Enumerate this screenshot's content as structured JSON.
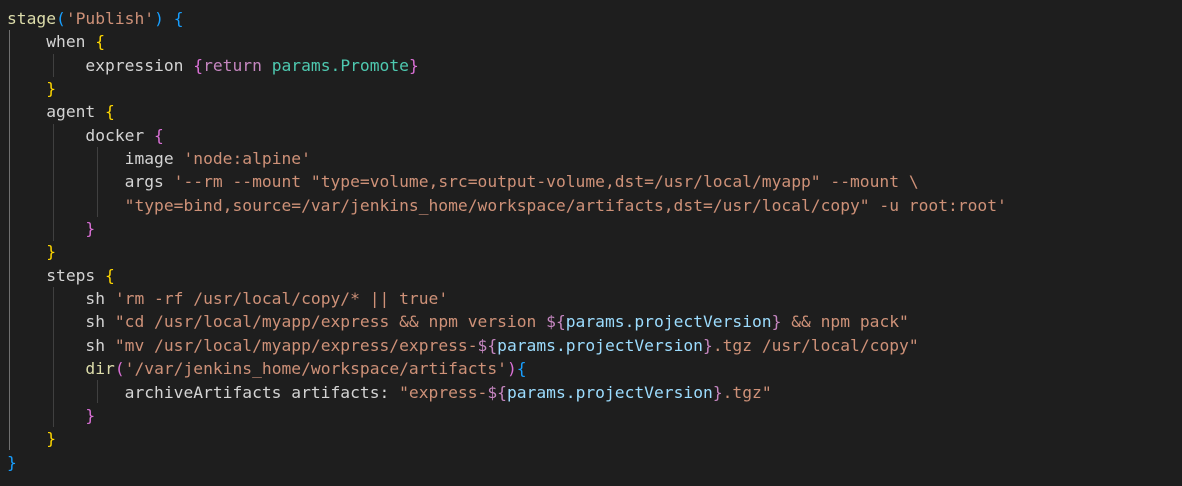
{
  "editor": {
    "language": "groovy",
    "colors": {
      "background": "#1e1e1e",
      "default": "#d4d4d4",
      "function": "#dcdcaa",
      "string": "#ce9178",
      "keyword": "#c586c0",
      "variable": "#9cdcfe",
      "bracket1": "#ffd700",
      "bracket2": "#da70d6",
      "bracket3": "#179fff"
    },
    "lines": [
      [
        [
          "t-fn",
          "stage"
        ],
        [
          "t-b3",
          "("
        ],
        [
          "t-str",
          "'Publish'"
        ],
        [
          "t-b3",
          ")"
        ],
        [
          "t-plain",
          " "
        ],
        [
          "t-b3",
          "{"
        ]
      ],
      [
        [
          "t-plain",
          "    "
        ],
        [
          "t-plain",
          "when "
        ],
        [
          "t-b1",
          "{"
        ]
      ],
      [
        [
          "t-plain",
          "        "
        ],
        [
          "t-plain",
          "expression "
        ],
        [
          "t-b2",
          "{"
        ],
        [
          "t-kw",
          "return"
        ],
        [
          "t-plain",
          " "
        ],
        [
          "t-var2",
          "params.Promote"
        ],
        [
          "t-b2",
          "}"
        ]
      ],
      [
        [
          "t-plain",
          "    "
        ],
        [
          "t-b1",
          "}"
        ]
      ],
      [
        [
          "t-plain",
          "    "
        ],
        [
          "t-plain",
          "agent "
        ],
        [
          "t-b1",
          "{"
        ]
      ],
      [
        [
          "t-plain",
          "        "
        ],
        [
          "t-plain",
          "docker "
        ],
        [
          "t-b2",
          "{"
        ]
      ],
      [
        [
          "t-plain",
          "            "
        ],
        [
          "t-plain",
          "image "
        ],
        [
          "t-str",
          "'node:alpine'"
        ]
      ],
      [
        [
          "t-plain",
          "            "
        ],
        [
          "t-plain",
          "args "
        ],
        [
          "t-str",
          "'--rm --mount \"type=volume,src=output-volume,dst=/usr/local/myapp\" --mount \\"
        ]
      ],
      [
        [
          "t-plain",
          "            "
        ],
        [
          "t-str",
          "\"type=bind,source=/var/jenkins_home/workspace/artifacts,dst=/usr/local/copy\" -u root:root'"
        ]
      ],
      [
        [
          "t-plain",
          "        "
        ],
        [
          "t-b2",
          "}"
        ]
      ],
      [
        [
          "t-plain",
          "    "
        ],
        [
          "t-b1",
          "}"
        ]
      ],
      [
        [
          "t-plain",
          "    "
        ],
        [
          "t-plain",
          "steps "
        ],
        [
          "t-b1",
          "{"
        ]
      ],
      [
        [
          "t-plain",
          "        "
        ],
        [
          "t-plain",
          "sh "
        ],
        [
          "t-str",
          "'rm -rf /usr/local/copy/* || true'"
        ]
      ],
      [
        [
          "t-plain",
          "        "
        ],
        [
          "t-plain",
          "sh "
        ],
        [
          "t-str",
          "\"cd /usr/local/myapp/express && npm version "
        ],
        [
          "t-kw",
          "${"
        ],
        [
          "t-var",
          "params.projectVersion"
        ],
        [
          "t-kw",
          "}"
        ],
        [
          "t-str",
          " && npm pack\""
        ]
      ],
      [
        [
          "t-plain",
          "        "
        ],
        [
          "t-plain",
          "sh "
        ],
        [
          "t-str",
          "\"mv /usr/local/myapp/express/express-"
        ],
        [
          "t-kw",
          "${"
        ],
        [
          "t-var",
          "params.projectVersion"
        ],
        [
          "t-kw",
          "}"
        ],
        [
          "t-str",
          ".tgz /usr/local/copy\""
        ]
      ],
      [
        [
          "t-plain",
          "        "
        ],
        [
          "t-fn",
          "dir"
        ],
        [
          "t-b2",
          "("
        ],
        [
          "t-str",
          "'/var/jenkins_home/workspace/artifacts'"
        ],
        [
          "t-b2",
          ")"
        ],
        [
          "t-b3",
          "{"
        ]
      ],
      [
        [
          "t-plain",
          "            "
        ],
        [
          "t-plain",
          "archiveArtifacts artifacts: "
        ],
        [
          "t-str",
          "\"express-"
        ],
        [
          "t-kw",
          "${"
        ],
        [
          "t-var",
          "params.projectVersion"
        ],
        [
          "t-kw",
          "}"
        ],
        [
          "t-str",
          ".tgz\""
        ]
      ],
      [
        [
          "t-plain",
          "        "
        ],
        [
          "t-b2",
          "}"
        ]
      ],
      [
        [
          "t-plain",
          "    "
        ],
        [
          "t-b1",
          "}"
        ]
      ],
      [
        [
          "t-b3",
          "}"
        ]
      ]
    ]
  }
}
